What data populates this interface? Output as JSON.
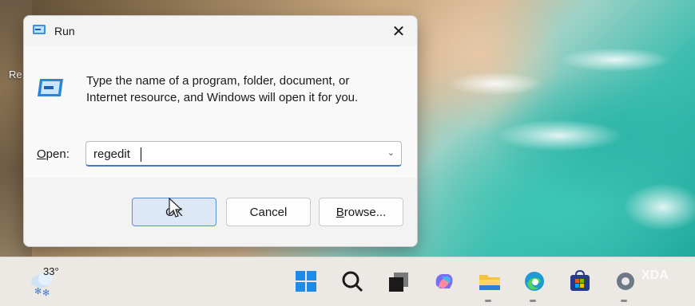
{
  "desktop": {
    "partial_label": "Re"
  },
  "dialog": {
    "title": "Run",
    "close_symbol": "✕",
    "description": "Type the name of a program, folder, document, or Internet resource, and Windows will open it for you.",
    "open_label_accel": "O",
    "open_label_rest": "pen:",
    "combo_value": "regedit",
    "buttons": {
      "ok": "OK",
      "cancel": "Cancel",
      "browse_accel": "B",
      "browse_rest": "rowse..."
    }
  },
  "taskbar": {
    "weather_temp": "33°",
    "icons": [
      "start-icon",
      "search-icon",
      "task-view-icon",
      "copilot-icon",
      "file-explorer-icon",
      "edge-icon",
      "microsoft-store-icon",
      "settings-icon"
    ]
  },
  "watermark": "XDA",
  "colors": {
    "accent": "#4a77c4",
    "ok_button_bg": "#dce8f5",
    "dialog_bg": "#f3f3f3"
  }
}
